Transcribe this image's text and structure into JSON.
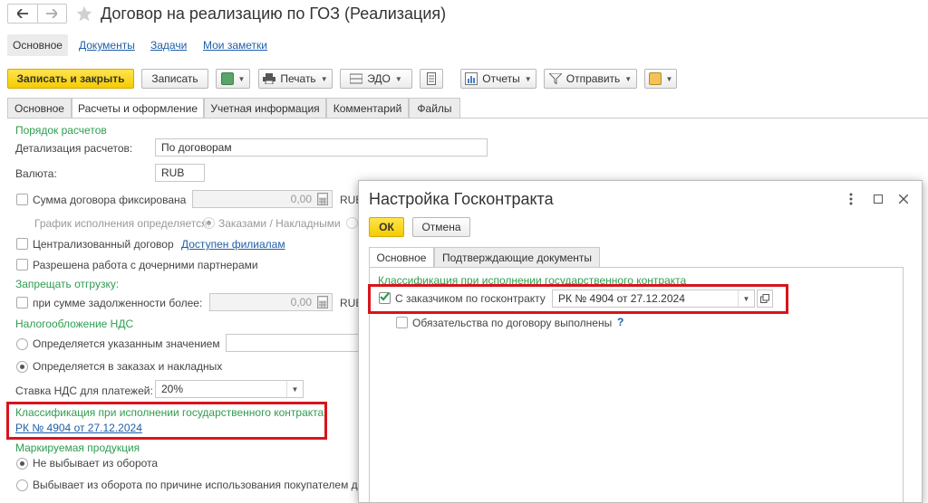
{
  "window": {
    "title": "Договор на реализацию по ГОЗ (Реализация)"
  },
  "nav_links": [
    "Основное",
    "Документы",
    "Задачи",
    "Мои заметки"
  ],
  "toolbar": {
    "save_close": "Записать и закрыть",
    "save": "Записать",
    "print": "Печать",
    "edo": "ЭДО",
    "reports": "Отчеты",
    "send": "Отправить"
  },
  "tabs": [
    "Основное",
    "Расчеты и оформление",
    "Учетная информация",
    "Комментарий",
    "Файлы"
  ],
  "form": {
    "settlement_section": "Порядок расчетов",
    "detail_label": "Детализация расчетов:",
    "detail_value": "По договорам",
    "currency_label": "Валюта:",
    "currency_value": "RUB",
    "fixed_sum_label": "Сумма договора фиксирована",
    "fixed_sum_value": "0,00",
    "fixed_sum_currency": "RUB",
    "schedule_label": "График исполнения определяется:",
    "schedule_option": "Заказами / Накладными",
    "centralized_label": "Централизованный договор",
    "branches_link": "Доступен филиалам",
    "subsidiaries_label": "Разрешена работа с дочерними партнерами",
    "prohibit_section": "Запрещать отгрузку:",
    "debt_label": "при сумме задолженности более:",
    "debt_value": "0,00",
    "debt_currency": "RUB",
    "vat_section": "Налогообложение НДС",
    "vat_option1": "Определяется указанным значением",
    "vat_option2": "Определяется в заказах и накладных",
    "vat_rate_label": "Ставка НДС для платежей:",
    "vat_rate_value": "20%",
    "gos_section": "Классификация при исполнении государственного контракта",
    "gos_link": "РК № 4904 от 27.12.2024",
    "marked_section": "Маркируемая продукция",
    "marked_option1": "Не выбывает из оборота",
    "marked_option2": "Выбывает из оборота по причине использования покупателем дл"
  },
  "dialog": {
    "title": "Настройка Госконтракта",
    "ok": "ОК",
    "cancel": "Отмена",
    "tabs": [
      "Основное",
      "Подтверждающие документы"
    ],
    "section": "Классификация при исполнении государственного контракта",
    "customer_label": "С заказчиком по госконтракту",
    "customer_value": "РК № 4904 от 27.12.2024",
    "obligations_label": "Обязательства по договору выполнены",
    "help": "?"
  }
}
